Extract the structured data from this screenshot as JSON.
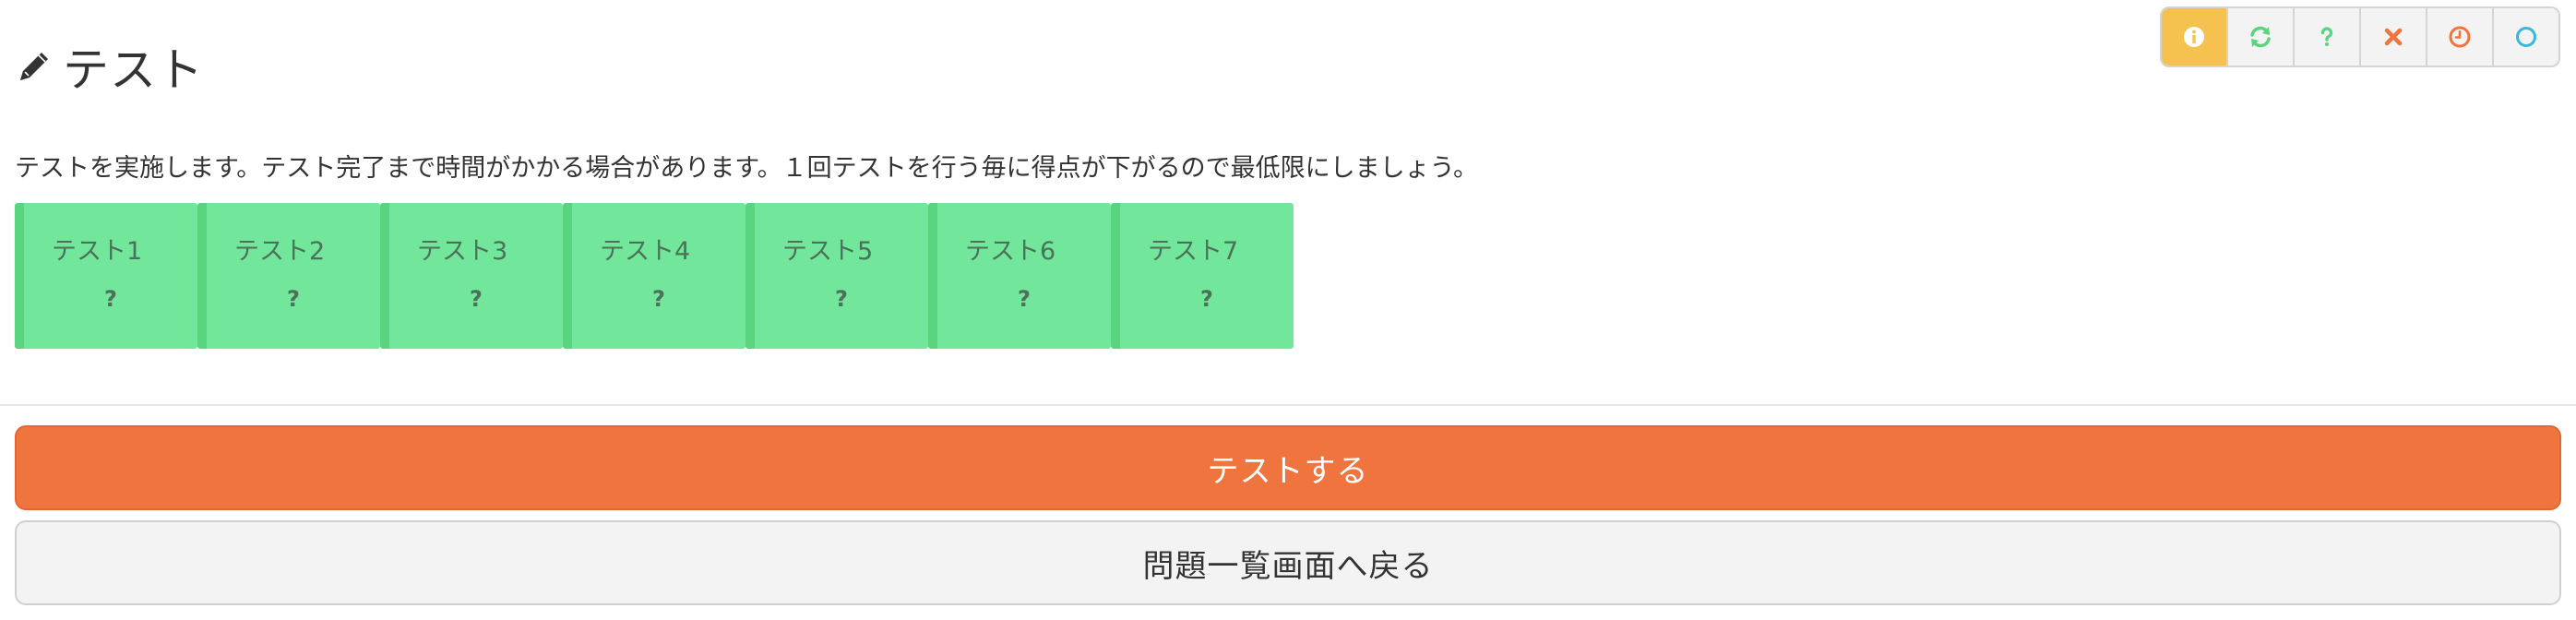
{
  "header": {
    "title": "テスト",
    "title_icon": "pencil-icon"
  },
  "toolbar": {
    "items": [
      {
        "icon": "info-icon",
        "color": "#ffffff",
        "active": true
      },
      {
        "icon": "refresh-icon",
        "color": "#5bd47f",
        "active": false
      },
      {
        "icon": "question-icon",
        "color": "#5bd47f",
        "active": false
      },
      {
        "icon": "close-icon",
        "color": "#f0743e",
        "active": false
      },
      {
        "icon": "clock-icon",
        "color": "#f0743e",
        "active": false
      },
      {
        "icon": "circle-icon",
        "color": "#3bb7d8",
        "active": false
      }
    ],
    "active_color": "#f6c24f"
  },
  "description": "テストを実施します。テスト完了まで時間がかかる場合があります。１回テストを行う毎に得点が下がるので最低限にしましょう。",
  "tests": [
    {
      "name": "テスト1",
      "result": "?"
    },
    {
      "name": "テスト2",
      "result": "?"
    },
    {
      "name": "テスト3",
      "result": "?"
    },
    {
      "name": "テスト4",
      "result": "?"
    },
    {
      "name": "テスト5",
      "result": "?"
    },
    {
      "name": "テスト6",
      "result": "?"
    },
    {
      "name": "テスト7",
      "result": "?"
    }
  ],
  "actions": {
    "run_label": "テストする",
    "back_label": "問題一覧画面へ戻る"
  },
  "colors": {
    "tile_bg": "#72e69b",
    "tile_border": "#5bd47f",
    "primary": "#f0743e",
    "secondary": "#f3f3f3"
  }
}
